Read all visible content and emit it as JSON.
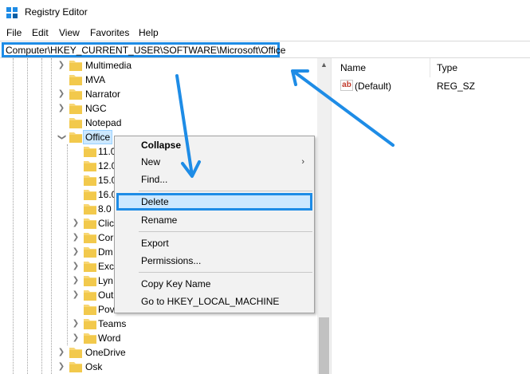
{
  "window": {
    "title": "Registry Editor"
  },
  "menu": [
    "File",
    "Edit",
    "View",
    "Favorites",
    "Help"
  ],
  "address": {
    "path": "Computer\\HKEY_CURRENT_USER\\SOFTWARE\\Microsoft\\Office"
  },
  "tree": {
    "siblings_before": [
      "Multimedia",
      "MVA",
      "Narrator",
      "NGC",
      "Notepad"
    ],
    "selected": "Office",
    "children": [
      "11.0",
      "12.0",
      "15.0",
      "16.0",
      "8.0",
      "Clic",
      "Cor",
      "Dm",
      "Exc",
      "Lyn",
      "Out",
      "Pov",
      "Teams",
      "Word"
    ],
    "siblings_after": [
      "OneDrive",
      "Osk"
    ]
  },
  "values": {
    "columns": [
      "Name",
      "Type"
    ],
    "rows": [
      {
        "name": "(Default)",
        "type": "REG_SZ"
      }
    ]
  },
  "context_menu": {
    "collapse": "Collapse",
    "new": "New",
    "find": "Find...",
    "delete": "Delete",
    "rename": "Rename",
    "export": "Export",
    "permissions": "Permissions...",
    "copy_key_name": "Copy Key Name",
    "goto": "Go to HKEY_LOCAL_MACHINE"
  },
  "colors": {
    "annotation": "#1e8ce6",
    "selection": "#cce8ff",
    "folder": "#f8d775"
  }
}
